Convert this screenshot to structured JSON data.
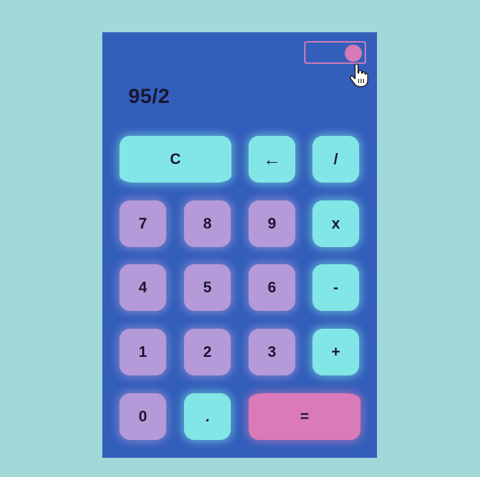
{
  "display": {
    "expression": "95/2"
  },
  "theme_toggle": {
    "state": "on"
  },
  "keys": {
    "clear": "C",
    "backspace_icon": "left-arrow-icon",
    "divide": "/",
    "seven": "7",
    "eight": "8",
    "nine": "9",
    "multiply": "x",
    "four": "4",
    "five": "5",
    "six": "6",
    "subtract": "-",
    "one": "1",
    "two": "2",
    "three": "3",
    "add": "+",
    "zero": "0",
    "decimal": ".",
    "equals": "="
  },
  "colors": {
    "background": "#a0d9d8",
    "calculator_body": "#335fbb",
    "number_key": "#b49ad8",
    "operator_key": "#82e6e6",
    "equals_key": "#db7ab8",
    "toggle": "#d67bb8",
    "text": "#1a1630"
  }
}
